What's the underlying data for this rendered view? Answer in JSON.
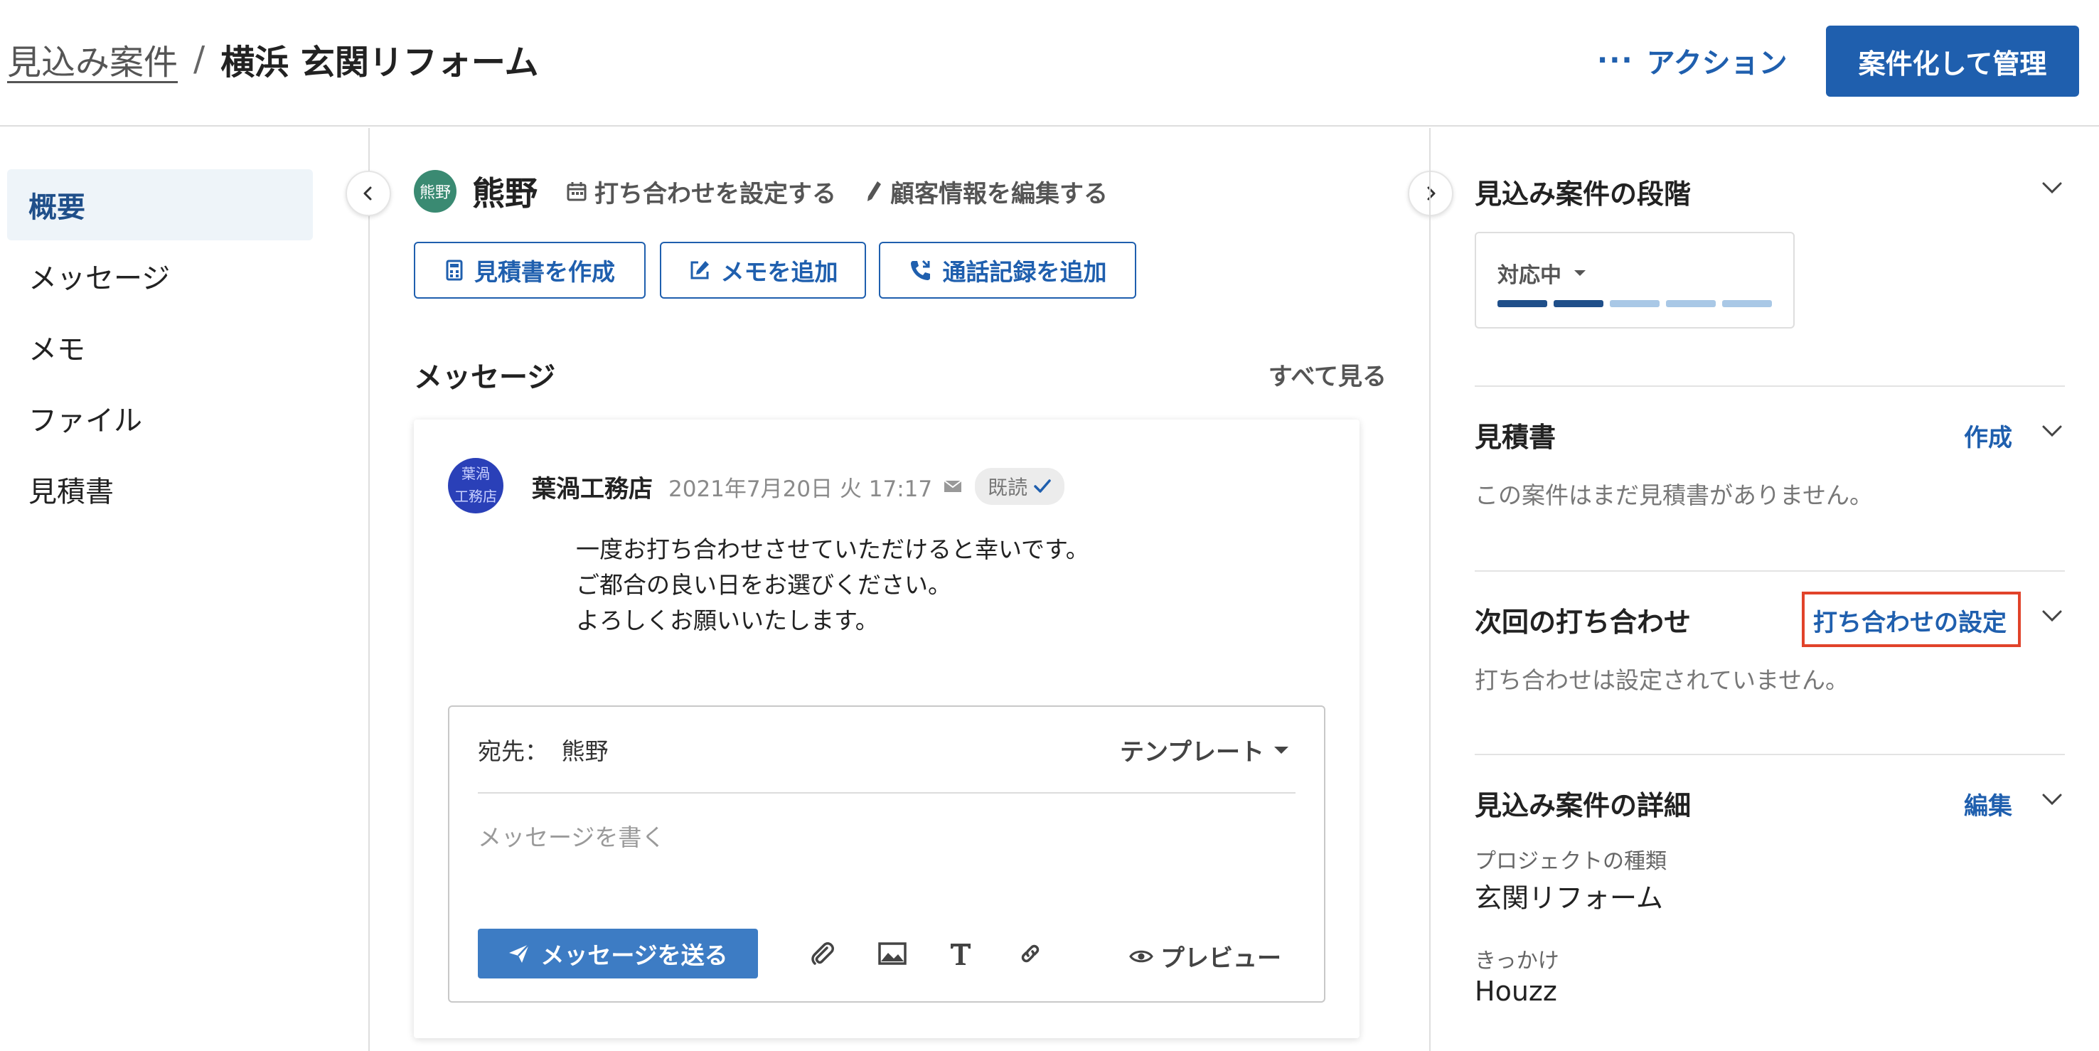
{
  "header": {
    "breadcrumb_parent": "見込み案件",
    "breadcrumb_sep": "/",
    "title": "横浜 玄関リフォーム",
    "action_dots": "···",
    "action_label": "アクション",
    "primary_button": "案件化して管理"
  },
  "sidebar": {
    "items": [
      {
        "label": "概要"
      },
      {
        "label": "メッセージ"
      },
      {
        "label": "メモ"
      },
      {
        "label": "ファイル"
      },
      {
        "label": "見積書"
      }
    ]
  },
  "main": {
    "customer": {
      "avatar_text": "熊野",
      "name": "熊野",
      "schedule_link": "打ち合わせを設定する",
      "edit_link": "顧客情報を編集する"
    },
    "buttons": {
      "create_quote": "見積書を作成",
      "add_memo": "メモを追加",
      "add_call_log": "通話記録を追加"
    },
    "messages": {
      "title": "メッセージ",
      "see_all": "すべて見る",
      "item": {
        "avatar_line1": "葉渦",
        "avatar_line2": "工務店",
        "sender": "葉渦工務店",
        "timestamp": "2021年7月20日 火 17:17",
        "read_badge": "既読",
        "body_lines": [
          "一度お打ち合わせさせていただけると幸いです。",
          "ご都合の良い日をお選びください。",
          "よろしくお願いいたします。"
        ]
      }
    },
    "composer": {
      "to_label": "宛先：",
      "to_value": "熊野",
      "template_label": "テンプレート",
      "placeholder": "メッセージを書く",
      "send_button": "メッセージを送る",
      "preview_label": "プレビュー"
    }
  },
  "right_panel": {
    "stage": {
      "title": "見込み案件の段階",
      "current": "対応中",
      "segments_total": 5,
      "segments_filled": 2,
      "filled_color": "#1f4f8a",
      "empty_color": "#a9c8e6"
    },
    "quotes": {
      "title": "見積書",
      "action": "作成",
      "empty_text": "この案件はまだ見積書がありません。"
    },
    "next_meeting": {
      "title": "次回の打ち合わせ",
      "action": "打ち合わせの設定",
      "empty_text": "打ち合わせは設定されていません。"
    },
    "details": {
      "title": "見込み案件の詳細",
      "action": "編集",
      "project_type_label": "プロジェクトの種類",
      "project_type_value": "玄関リフォーム",
      "source_label": "きっかけ",
      "source_value": "Houzz"
    }
  },
  "colors": {
    "brand_blue": "#1f5fae",
    "highlight_red": "#e1432a",
    "active_nav_bg": "#eef4f9"
  }
}
